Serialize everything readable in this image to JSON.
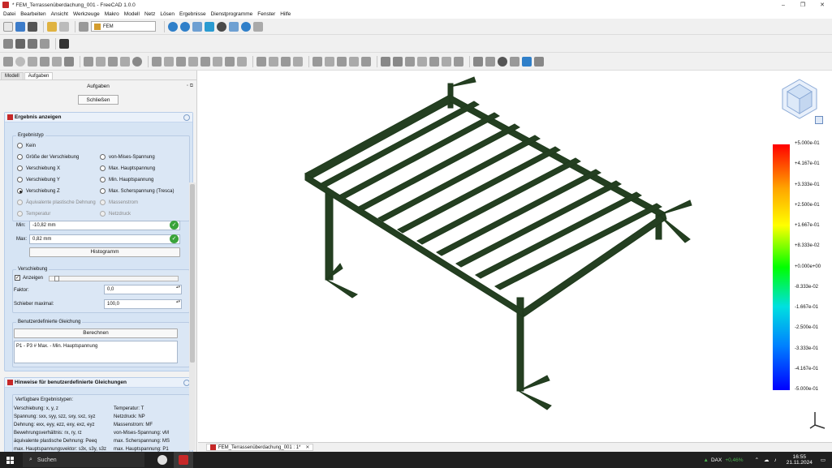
{
  "window": {
    "title": "* FEM_Terrassenüberdachung_001 - FreeCAD 1.0.0",
    "min_icon": "–",
    "max_icon": "❐",
    "close_icon": "✕"
  },
  "menu": [
    "Datei",
    "Bearbeiten",
    "Ansicht",
    "Werkzeuge",
    "Makro",
    "Modell",
    "Netz",
    "Lösen",
    "Ergebnisse",
    "Dienstprogramme",
    "Fenster",
    "Hilfe"
  ],
  "toolbar": {
    "workbench": "FEM"
  },
  "panel": {
    "tabs": [
      "Modell",
      "Aufgaben"
    ],
    "header": "Aufgaben",
    "close_button": "Schließen",
    "result_box": {
      "title": "Ergebnis anzeigen",
      "group_title": "Ergebnistyp",
      "radios_left": [
        "Kein",
        "Größe der Verschiebung",
        "Verschiebung X",
        "Verschiebung Y",
        "Verschiebung Z",
        "Äquivalente plastische Dehnung",
        "Temperatur"
      ],
      "radios_right": [
        "von-Mises-Spannung",
        "Max. Hauptspannung",
        "Min. Hauptspannung",
        "Max. Scherspannung (Tresca)",
        "Massenstrom",
        "Netzdruck"
      ],
      "selected": "Verschiebung Z",
      "min_label": "Min:",
      "min_value": "-10,82 mm",
      "max_label": "Max:",
      "max_value": "0,82 mm",
      "histogram_button": "Histogramm"
    },
    "displacement": {
      "title": "Verschiebung",
      "show_label": "Anzeigen",
      "show_checked": true,
      "factor_label": "Faktor:",
      "factor_value": "0,0",
      "slider_max_label": "Schieber maximal:",
      "slider_max_value": "100,0"
    },
    "equation": {
      "title": "Benutzerdefinierte Gleichung",
      "calc_button": "Berechnen",
      "text": "P1 - P3 # Max. - Min. Hauptspannung"
    },
    "hints": {
      "title": "Hinweise für benutzerdefinierte Gleichungen",
      "heading": "Verfügbare Ergebnistypen:",
      "left": [
        "Verschiebung: x, y, z",
        "Spannung: sxx, syy, szz, sxy, sxz, syz",
        "Dehnung: exx, eyy, ezz, exy, exz, eyz",
        "Bewehrungsverhältnis: rx, ry, rz",
        "äquivalente plastische Dehnung: Peeq",
        "max. Hauptspannungsvektor: s3x, s3y, s3z"
      ],
      "right": [
        "Temperatur: T",
        "Netzdruck: NP",
        "Massenstrom: MF",
        "von-Mises-Spannung: vM",
        "max. Scherspannung: MS",
        "max. Hauptspannung: P1"
      ]
    }
  },
  "legend": {
    "labels": [
      "+5.000e-01",
      "+4.167e-01",
      "+3.333e-01",
      "+2.500e-01",
      "+1.667e-01",
      "+8.333e-02",
      "+0.000e+00",
      "-8.333e-02",
      "-1.667e-01",
      "-2.500e-01",
      "-3.333e-01",
      "-4.167e-01",
      "-5.000e-01"
    ]
  },
  "document_tab": "FEM_Terrassenüberdachung_001 : 1*",
  "taskbar": {
    "search": "Suchen",
    "ticker": "DAX",
    "ticker_change": "+0,46%",
    "time": "16:55",
    "date": "21.11.2024"
  },
  "colors": {
    "accent": "#c62828",
    "panel_blue": "#d6e4f4",
    "beam": "#1f3a1c"
  }
}
